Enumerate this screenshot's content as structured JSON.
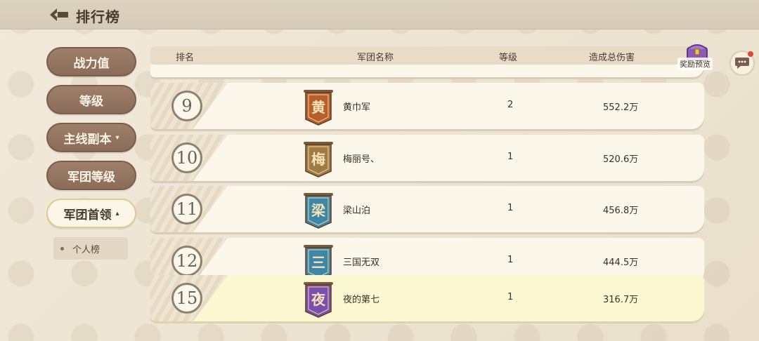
{
  "header": {
    "title": "排行榜"
  },
  "sidebar": {
    "items": [
      {
        "label": "战力值"
      },
      {
        "label": "等级"
      },
      {
        "label": "主线副本",
        "caret": "▾"
      },
      {
        "label": "军团等级"
      },
      {
        "label": "军团首领",
        "caret": "▴"
      }
    ],
    "sub_item": "个人榜"
  },
  "table": {
    "headers": {
      "rank": "排名",
      "name": "军团名称",
      "level": "等级",
      "damage": "造成总伤害"
    },
    "rows": [
      {
        "rank": "9",
        "emblem": "黄",
        "color": "#b85d2c",
        "name": "黄巾军",
        "level": "2",
        "damage": "552.2万"
      },
      {
        "rank": "10",
        "emblem": "梅",
        "color": "#a07a45",
        "name": "梅丽号、",
        "level": "1",
        "damage": "520.6万"
      },
      {
        "rank": "11",
        "emblem": "梁",
        "color": "#3d86a8",
        "name": "梁山泊",
        "level": "1",
        "damage": "456.8万"
      },
      {
        "rank": "12",
        "emblem": "三",
        "color": "#3d86a8",
        "name": "三国无双",
        "level": "1",
        "damage": "444.5万"
      }
    ],
    "self_row": {
      "rank": "15",
      "emblem": "夜",
      "color": "#7a4fb0",
      "name": "夜的第七",
      "level": "1",
      "damage": "316.7万"
    }
  },
  "reward": {
    "label": "奖励预览",
    "icon": "treasure-chest-icon"
  },
  "chat": {
    "icon": "chat-bubble-icon"
  }
}
